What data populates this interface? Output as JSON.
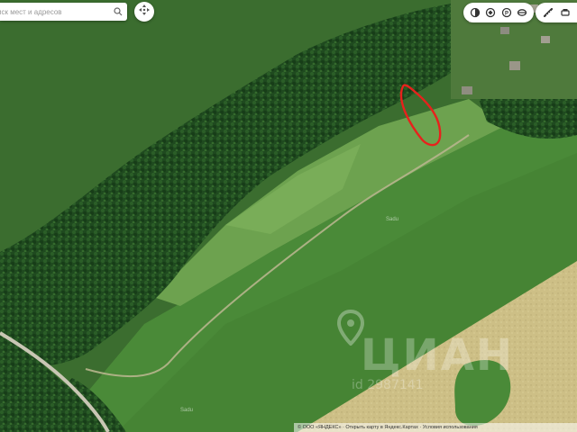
{
  "search": {
    "placeholder": "иск мест и адресов",
    "icon": "search-icon"
  },
  "controls": {
    "locate": "move-arrows-icon",
    "layers": [
      "layer-circle-icon",
      "route-icon",
      "parking-icon",
      "traffic-icon"
    ],
    "tools": [
      "ruler-icon",
      "print-icon"
    ]
  },
  "map": {
    "type": "satellite",
    "colors": {
      "field_green": "#3f7a34",
      "forest_dark": "#1f4a1f",
      "meadow_light": "#6da24f",
      "wheat_field": "#cdbf86",
      "road": "#c9c6b4",
      "marker": "#e8211c"
    },
    "labels": [
      {
        "id": "field-label-center",
        "text": "Sadu"
      },
      {
        "id": "field-label-bottom",
        "text": "Sadu"
      }
    ],
    "highlight": {
      "shape": "freehand-loop",
      "color": "#e8211c"
    }
  },
  "watermark": {
    "logo_text": "ЦИАН",
    "sub_text": "id 2987141"
  },
  "attribution": "© ООО «ЯНДЕКС» · Открыть карту в Яндекс.Картах · Условия использования"
}
